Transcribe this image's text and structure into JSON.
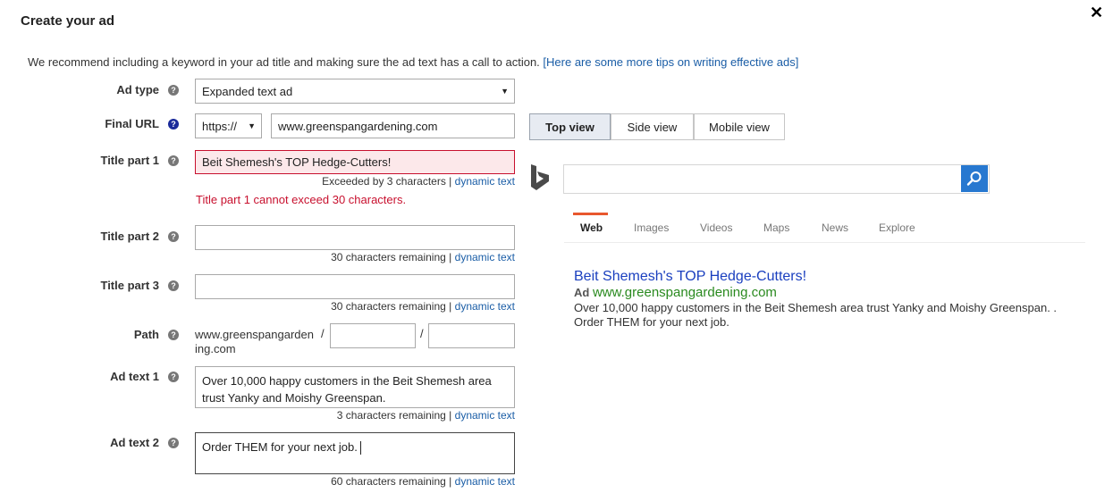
{
  "dialog": {
    "title": "Create your ad",
    "close_label": "✕"
  },
  "recommendation": {
    "text": "We recommend including a keyword in your ad title and making sure the ad text has a call to action.",
    "link": "[Here are some more tips on writing effective ads]"
  },
  "help_icon": "?",
  "dynamic_text": "dynamic text",
  "separator": "|",
  "form": {
    "ad_type": {
      "label": "Ad type",
      "value": "Expanded text ad"
    },
    "final_url": {
      "label": "Final URL",
      "protocol": "https://",
      "value": "www.greenspangardening.com"
    },
    "title1": {
      "label": "Title part 1",
      "value": "Beit Shemesh's TOP Hedge-Cutters!",
      "hint": "Exceeded by 3 characters",
      "error": "Title part 1 cannot exceed 30 characters."
    },
    "title2": {
      "label": "Title part 2",
      "value": "",
      "hint": "30 characters remaining"
    },
    "title3": {
      "label": "Title part 3",
      "value": "",
      "hint": "30 characters remaining"
    },
    "path": {
      "label": "Path",
      "domain_line1": "www.greenspangarden",
      "domain_line2": "ing.com",
      "slash": "/",
      "path1": "",
      "path2": ""
    },
    "ad_text1": {
      "label": "Ad text 1",
      "value": "Over 10,000 happy customers in the Beit Shemesh area trust Yanky and Moishy Greenspan.",
      "hint": "3 characters remaining"
    },
    "ad_text2": {
      "label": "Ad text 2",
      "value": "Order THEM for your next job.",
      "hint": "60 characters remaining"
    }
  },
  "preview": {
    "views": [
      "Top view",
      "Side view",
      "Mobile view"
    ],
    "active_view": "Top view",
    "tabs": [
      "Web",
      "Images",
      "Videos",
      "Maps",
      "News",
      "Explore"
    ],
    "active_tab": "Web",
    "result": {
      "title": "Beit Shemesh's TOP Hedge-Cutters!",
      "ad_label": "Ad",
      "url": "www.greenspangardening.com",
      "desc_line1": "Over 10,000 happy customers in the Beit Shemesh area trust Yanky and Moishy Greenspan. .",
      "desc_line2": "Order THEM for your next job."
    }
  },
  "colors": {
    "error": "#c8102e",
    "link": "#1a5da6",
    "bing_blue": "#2778d0",
    "result_title": "#1a3fbf",
    "result_url": "#2a8a1f",
    "tab_underline": "#e8572e"
  }
}
